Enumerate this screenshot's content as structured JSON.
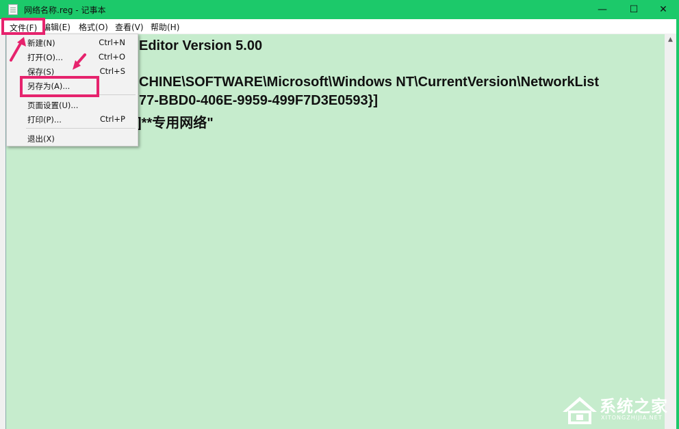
{
  "window": {
    "title": "网络名称.reg - 记事本"
  },
  "menu": [
    "文件(F)",
    "编辑(E)",
    "格式(O)",
    "查看(V)",
    "帮助(H)"
  ],
  "file_menu": {
    "items": [
      {
        "label": "新建(N)",
        "shortcut": "Ctrl+N"
      },
      {
        "label": "打开(O)...",
        "shortcut": "Ctrl+O"
      },
      {
        "label": "保存(S)",
        "shortcut": "Ctrl+S"
      },
      {
        "label": "另存为(A)...",
        "shortcut": ""
      },
      {
        "label": "页面设置(U)...",
        "shortcut": ""
      },
      {
        "label": "打印(P)...",
        "shortcut": "Ctrl+P"
      },
      {
        "label": "退出(X)",
        "shortcut": ""
      }
    ]
  },
  "content": {
    "line1": "Editor Version 5.00",
    "line2": "CHINE\\SOFTWARE\\Microsoft\\Windows NT\\CurrentVersion\\NetworkList",
    "line3": "77-BBD0-406E-9959-499F7D3E0593}]",
    "line4": "]**专用网络\""
  },
  "watermark": {
    "name": "系统之家",
    "url": "XITONGZHIJIA.NET"
  },
  "colors": {
    "titlebar": "#1cc96a",
    "editor_bg": "#c6eccd",
    "highlight": "#e6236d"
  }
}
